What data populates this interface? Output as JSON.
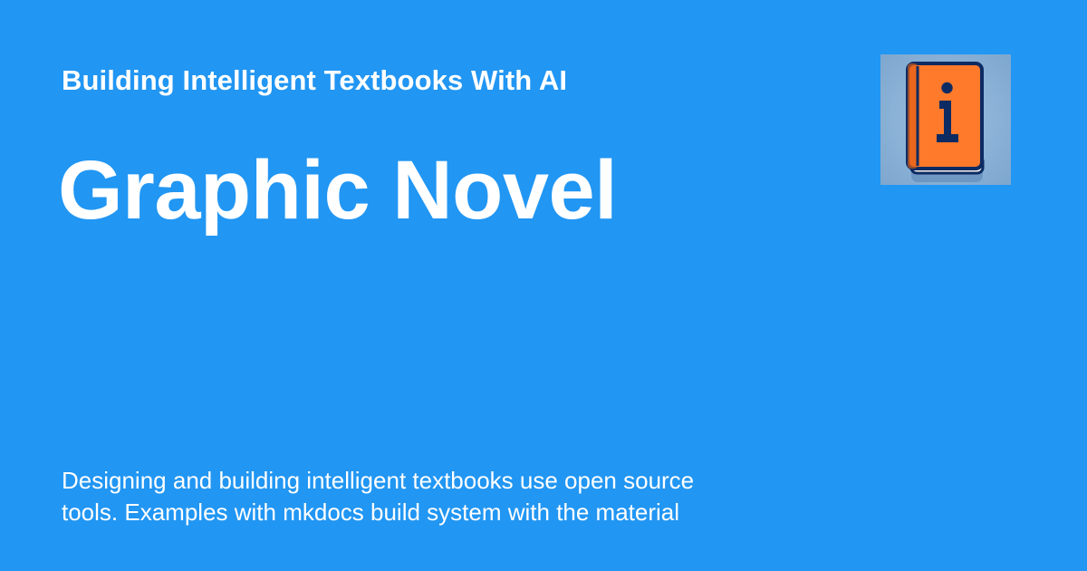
{
  "card": {
    "site_name": "Building Intelligent Textbooks With AI",
    "page_title": "Graphic Novel",
    "description": "Designing and building intelligent textbooks use open source\ntools.  Examples with mkdocs build system with the material",
    "logo": {
      "icon": "book-info-icon",
      "glyph": "i"
    }
  },
  "colors": {
    "background": "#2196f3",
    "text": "#ffffff",
    "logo_background": "#86aed4",
    "book_cover": "#ff7a2a",
    "book_spine": "#e05d14",
    "book_outline": "#0d2b63"
  }
}
